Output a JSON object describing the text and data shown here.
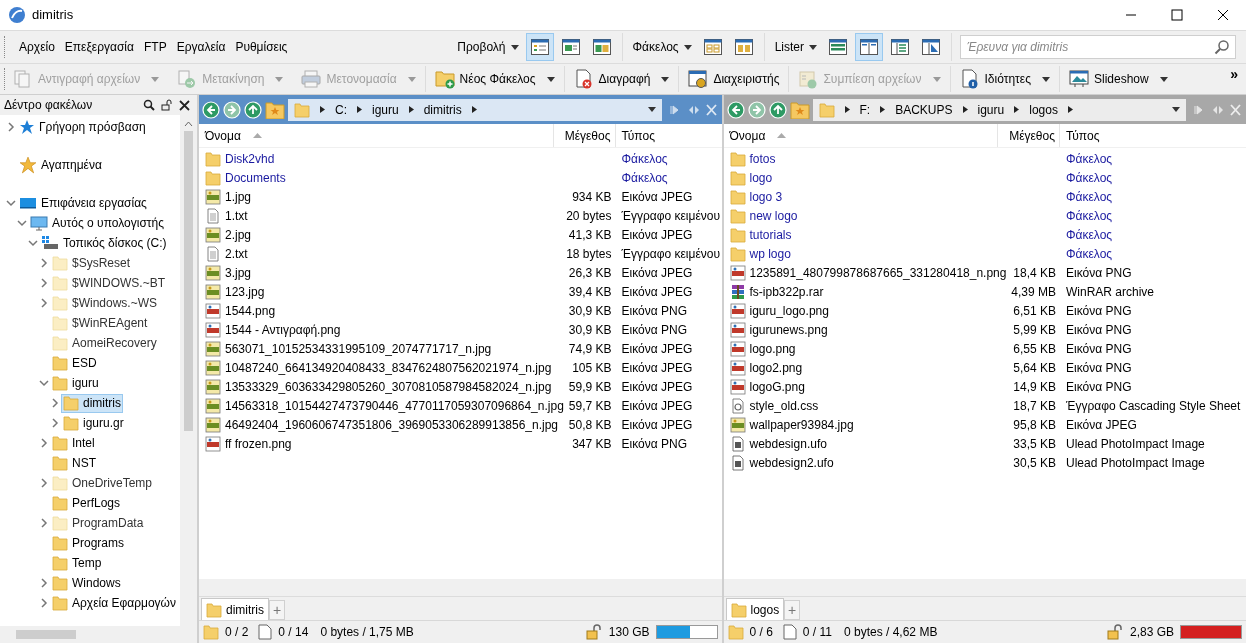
{
  "window": {
    "title": "dimitris"
  },
  "menu": [
    "Αρχείο",
    "Επεξεργασία",
    "FTP",
    "Εργαλεία",
    "Ρυθμίσεις"
  ],
  "view_groups": [
    {
      "label": "Προβολή",
      "buttons": [
        {
          "kind": "details",
          "selected": true
        },
        {
          "kind": "preview",
          "selected": false
        },
        {
          "kind": "dual",
          "selected": false
        }
      ]
    },
    {
      "label": "Φάκελος",
      "buttons": [
        {
          "kind": "grid",
          "selected": false
        },
        {
          "kind": "columns",
          "selected": false
        }
      ]
    },
    {
      "label": "Lister",
      "buttons": [
        {
          "kind": "rows",
          "selected": false
        },
        {
          "kind": "split",
          "selected": true
        },
        {
          "kind": "tree",
          "selected": false
        },
        {
          "kind": "viewer",
          "selected": false
        }
      ]
    }
  ],
  "search": {
    "placeholder": "Έρευνα για dimitris"
  },
  "toolbar": [
    {
      "kind": "copy",
      "label": "Αντιγραφή αρχείων",
      "disabled": true,
      "dropdown": true
    },
    {
      "kind": "move",
      "label": "Μετακίνηση",
      "disabled": true,
      "dropdown": true
    },
    {
      "kind": "rename",
      "label": "Μετονομασία",
      "disabled": true,
      "dropdown": true
    },
    {
      "kind": "newfolder",
      "label": "Νέος Φάκελος",
      "disabled": false,
      "dropdown": true
    },
    {
      "kind": "delete",
      "label": "Διαγραφή",
      "disabled": false,
      "dropdown": true
    },
    {
      "kind": "admin",
      "label": "Διαχειριστής",
      "disabled": false,
      "dropdown": false
    },
    {
      "kind": "zip",
      "label": "Συμπίεση αρχείων",
      "disabled": true,
      "dropdown": true
    },
    {
      "kind": "properties",
      "label": "Ιδιότητες",
      "disabled": false,
      "dropdown": true
    },
    {
      "kind": "slideshow",
      "label": "Slideshow",
      "disabled": false,
      "dropdown": true
    }
  ],
  "toolbar_more": "»",
  "tree": {
    "title": "Δέντρο φακέλων",
    "items": [
      {
        "kind": "quick",
        "label": "Γρήγορη πρόσβαση",
        "expandable": true,
        "expanded": false,
        "hidden": false,
        "selected": false
      },
      {
        "kind": "star",
        "label": "Αγαπημένα",
        "expandable": false,
        "hidden": false,
        "selected": false
      },
      {
        "kind": "desktop",
        "label": "Επιφάνεια εργασίας",
        "expandable": true,
        "expanded": true,
        "hidden": false,
        "selected": false,
        "children": [
          {
            "kind": "computer",
            "label": "Αυτός ο υπολογιστής",
            "expandable": true,
            "expanded": true,
            "hidden": false,
            "selected": false,
            "children": [
              {
                "kind": "drive",
                "label": "Τοπικός δίσκος (C:)",
                "expandable": true,
                "expanded": true,
                "hidden": false,
                "selected": false,
                "children": [
                  {
                    "kind": "folder",
                    "label": "$SysReset",
                    "expandable": true,
                    "expanded": false,
                    "hidden": true,
                    "selected": false
                  },
                  {
                    "kind": "folder",
                    "label": "$WINDOWS.~BT",
                    "expandable": true,
                    "expanded": false,
                    "hidden": true,
                    "selected": false
                  },
                  {
                    "kind": "folder",
                    "label": "$Windows.~WS",
                    "expandable": true,
                    "expanded": false,
                    "hidden": true,
                    "selected": false
                  },
                  {
                    "kind": "folder",
                    "label": "$WinREAgent",
                    "expandable": false,
                    "hidden": true,
                    "selected": false
                  },
                  {
                    "kind": "folder",
                    "label": "AomeiRecovery",
                    "expandable": false,
                    "hidden": true,
                    "selected": false
                  },
                  {
                    "kind": "folder",
                    "label": "ESD",
                    "expandable": false,
                    "hidden": false,
                    "selected": false
                  },
                  {
                    "kind": "folder",
                    "label": "iguru",
                    "expandable": true,
                    "expanded": true,
                    "hidden": false,
                    "selected": false,
                    "children": [
                      {
                        "kind": "folder",
                        "label": "dimitris",
                        "expandable": true,
                        "expanded": false,
                        "hidden": false,
                        "selected": true
                      },
                      {
                        "kind": "folder",
                        "label": "iguru.gr",
                        "expandable": true,
                        "expanded": false,
                        "hidden": false,
                        "selected": false
                      }
                    ]
                  },
                  {
                    "kind": "folder",
                    "label": "Intel",
                    "expandable": true,
                    "expanded": false,
                    "hidden": false,
                    "selected": false
                  },
                  {
                    "kind": "folder",
                    "label": "NST",
                    "expandable": false,
                    "hidden": false,
                    "selected": false
                  },
                  {
                    "kind": "folder",
                    "label": "OneDriveTemp",
                    "expandable": true,
                    "expanded": false,
                    "hidden": true,
                    "selected": false
                  },
                  {
                    "kind": "folder",
                    "label": "PerfLogs",
                    "expandable": false,
                    "hidden": false,
                    "selected": false
                  },
                  {
                    "kind": "folder",
                    "label": "ProgramData",
                    "expandable": true,
                    "expanded": false,
                    "hidden": true,
                    "selected": false
                  },
                  {
                    "kind": "folder",
                    "label": "Programs",
                    "expandable": false,
                    "hidden": false,
                    "selected": false
                  },
                  {
                    "kind": "folder",
                    "label": "Temp",
                    "expandable": false,
                    "hidden": false,
                    "selected": false
                  },
                  {
                    "kind": "folder",
                    "label": "Windows",
                    "expandable": true,
                    "expanded": false,
                    "hidden": false,
                    "selected": false
                  },
                  {
                    "kind": "folder",
                    "label": "Αρχεία Εφαρμογών",
                    "expandable": true,
                    "expanded": false,
                    "hidden": false,
                    "selected": false
                  }
                ]
              }
            ]
          }
        ]
      }
    ]
  },
  "panes": [
    {
      "active": true,
      "path": [
        "C:",
        "iguru",
        "dimitris"
      ],
      "columns": [
        "Όνομα",
        "Μέγεθος",
        "Τύπος"
      ],
      "rows": [
        {
          "kind": "folder",
          "name": "Disk2vhd",
          "type": "Φάκελος"
        },
        {
          "kind": "folder",
          "name": "Documents",
          "type": "Φάκελος"
        },
        {
          "kind": "jpg",
          "name": "1.jpg",
          "size": "934 KB",
          "type": "Εικόνα JPEG"
        },
        {
          "kind": "txt",
          "name": "1.txt",
          "size": "20 bytes",
          "type": "Έγγραφο κειμένου"
        },
        {
          "kind": "jpg",
          "name": "2.jpg",
          "size": "41,3 KB",
          "type": "Εικόνα JPEG"
        },
        {
          "kind": "txt",
          "name": "2.txt",
          "size": "18 bytes",
          "type": "Έγγραφο κειμένου"
        },
        {
          "kind": "jpg",
          "name": "3.jpg",
          "size": "26,3 KB",
          "type": "Εικόνα JPEG"
        },
        {
          "kind": "jpg",
          "name": "123.jpg",
          "size": "39,4 KB",
          "type": "Εικόνα JPEG"
        },
        {
          "kind": "png",
          "name": "1544.png",
          "size": "30,9 KB",
          "type": "Εικόνα PNG"
        },
        {
          "kind": "png",
          "name": "1544 - Αντιγραφή.png",
          "size": "30,9 KB",
          "type": "Εικόνα PNG"
        },
        {
          "kind": "jpg",
          "name": "563071_10152534331995109_2074771717_n.jpg",
          "size": "74,9 KB",
          "type": "Εικόνα JPEG"
        },
        {
          "kind": "jpg",
          "name": "10487240_664134920408433_8347624807562021974_n.jpg",
          "size": "105 KB",
          "type": "Εικόνα JPEG"
        },
        {
          "kind": "jpg",
          "name": "13533329_603633429805260_3070810587984582024_n.jpg",
          "size": "59,9 KB",
          "type": "Εικόνα JPEG"
        },
        {
          "kind": "jpg",
          "name": "14563318_10154427473790446_4770117059307096864_n.jpg",
          "size": "59,7 KB",
          "type": "Εικόνα JPEG"
        },
        {
          "kind": "jpg",
          "name": "46492404_1960606747351806_3969053306289913856_n.jpg",
          "size": "50,8 KB",
          "type": "Εικόνα JPEG"
        },
        {
          "kind": "png",
          "name": "ff frozen.png",
          "size": "347 KB",
          "type": "Εικόνα PNG"
        }
      ],
      "tab": {
        "label": "dimitris",
        "add": "+"
      },
      "status": {
        "folders": "0 / 2",
        "files": "0 / 14",
        "bytes": "0 bytes / 1,75 MB",
        "free": "130 GB",
        "level": 0.55,
        "color": "#1e9be0"
      }
    },
    {
      "active": false,
      "path": [
        "F:",
        "BACKUPS",
        "iguru",
        "logos"
      ],
      "columns": [
        "Όνομα",
        "Μέγεθος",
        "Τύπος"
      ],
      "rows": [
        {
          "kind": "folder",
          "name": "fotos",
          "type": "Φάκελος"
        },
        {
          "kind": "folder",
          "name": "logo",
          "type": "Φάκελος"
        },
        {
          "kind": "folder",
          "name": "logo 3",
          "type": "Φάκελος"
        },
        {
          "kind": "folder",
          "name": "new logo",
          "type": "Φάκελος"
        },
        {
          "kind": "folder",
          "name": "tutorials",
          "type": "Φάκελος"
        },
        {
          "kind": "folder",
          "name": "wp logo",
          "type": "Φάκελος"
        },
        {
          "kind": "png",
          "name": "1235891_480799878687665_331280418_n.png",
          "size": "18,4 KB",
          "type": "Εικόνα PNG"
        },
        {
          "kind": "rar",
          "name": "fs-ipb322p.rar",
          "size": "4,39 MB",
          "type": "WinRAR archive"
        },
        {
          "kind": "png",
          "name": "iguru_logo.png",
          "size": "6,51 KB",
          "type": "Εικόνα PNG"
        },
        {
          "kind": "png",
          "name": "igurunews.png",
          "size": "5,99 KB",
          "type": "Εικόνα PNG"
        },
        {
          "kind": "png",
          "name": "logo.png",
          "size": "6,55 KB",
          "type": "Εικόνα PNG"
        },
        {
          "kind": "png",
          "name": "logo2.png",
          "size": "5,64 KB",
          "type": "Εικόνα PNG"
        },
        {
          "kind": "png",
          "name": "logoG.png",
          "size": "14,9 KB",
          "type": "Εικόνα PNG"
        },
        {
          "kind": "css",
          "name": "style_old.css",
          "size": "18,7 KB",
          "type": "Έγγραφο Cascading Style Sheet"
        },
        {
          "kind": "jpg",
          "name": "wallpaper93984.jpg",
          "size": "95,8 KB",
          "type": "Εικόνα JPEG"
        },
        {
          "kind": "ufo",
          "name": "webdesign.ufo",
          "size": "33,5 KB",
          "type": "Ulead PhotoImpact Image"
        },
        {
          "kind": "ufo",
          "name": "webdesign2.ufo",
          "size": "30,5 KB",
          "type": "Ulead PhotoImpact Image"
        }
      ],
      "tab": {
        "label": "logos",
        "add": "+"
      },
      "status": {
        "folders": "0 / 6",
        "files": "0 / 11",
        "bytes": "0 bytes / 4,62 MB",
        "free": "2,83 GB",
        "level": 1,
        "color": "#d42020"
      }
    }
  ]
}
